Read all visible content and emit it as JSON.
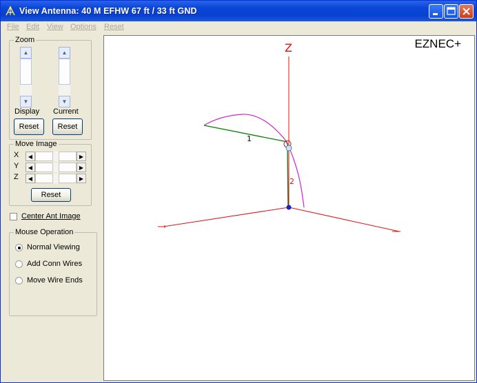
{
  "window": {
    "title": "View Antenna: 40 M EFHW 67 ft / 33 ft GND"
  },
  "menu": [
    "File",
    "Edit",
    "View",
    "Options",
    "Reset"
  ],
  "zoom": {
    "group_label": "Zoom",
    "display_label": "Display",
    "current_label": "Current",
    "reset_label": "Reset"
  },
  "move_image": {
    "group_label": "Move Image",
    "axes": [
      "X",
      "Y",
      "Z"
    ],
    "reset_label": "Reset"
  },
  "center_ant": {
    "label": "Center Ant Image",
    "checked": false
  },
  "mouse_operation": {
    "group_label": "Mouse Operation",
    "options": [
      "Normal Viewing",
      "Add Conn Wires",
      "Move Wire Ends"
    ],
    "selected": "Normal Viewing"
  },
  "canvas": {
    "brand": "EZNEC+",
    "z_axis_label": "Z",
    "wire_labels": [
      "1",
      "2"
    ]
  },
  "colors": {
    "axis": "#e01010",
    "wire": "#008000",
    "pattern": "#d020d0",
    "title_bar": "#0841d0"
  }
}
